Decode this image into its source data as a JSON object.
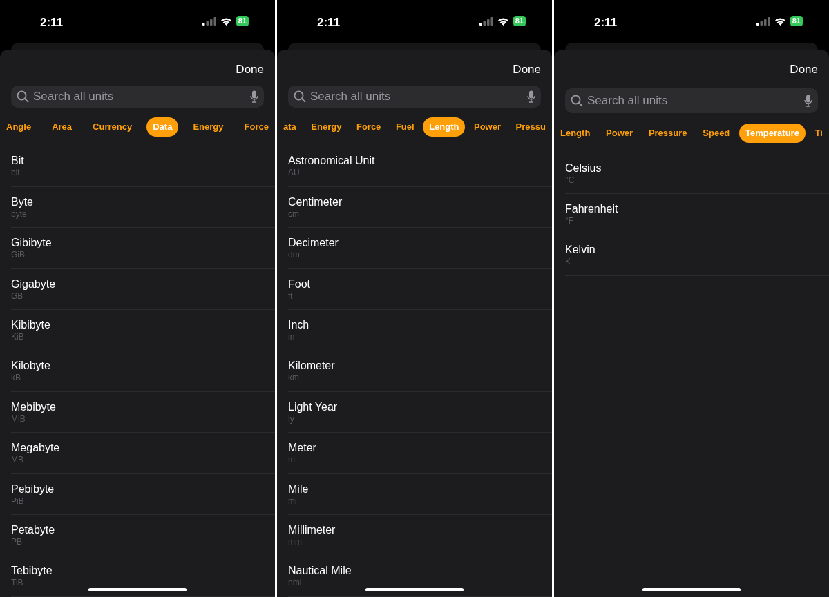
{
  "panels": [
    {
      "status": {
        "time": "2:11",
        "battery": "81"
      },
      "done": "Done",
      "search": {
        "placeholder": "Search all units"
      },
      "tabs": [
        {
          "label": "Angle",
          "selected": false
        },
        {
          "label": "Area",
          "selected": false
        },
        {
          "label": "Currency",
          "selected": false
        },
        {
          "label": "Data",
          "selected": true
        },
        {
          "label": "Energy",
          "selected": false
        },
        {
          "label": "Force",
          "selected": false
        }
      ],
      "units": [
        {
          "name": "Bit",
          "symbol": "bit"
        },
        {
          "name": "Byte",
          "symbol": "byte"
        },
        {
          "name": "Gibibyte",
          "symbol": "GiB"
        },
        {
          "name": "Gigabyte",
          "symbol": "GB"
        },
        {
          "name": "Kibibyte",
          "symbol": "KiB"
        },
        {
          "name": "Kilobyte",
          "symbol": "kB"
        },
        {
          "name": "Mebibyte",
          "symbol": "MiB"
        },
        {
          "name": "Megabyte",
          "symbol": "MB"
        },
        {
          "name": "Pebibyte",
          "symbol": "PiB"
        },
        {
          "name": "Petabyte",
          "symbol": "PB"
        },
        {
          "name": "Tebibyte",
          "symbol": "TiB"
        }
      ]
    },
    {
      "status": {
        "time": "2:11",
        "battery": "81"
      },
      "done": "Done",
      "search": {
        "placeholder": "Search all units"
      },
      "tabs": [
        {
          "label": "ata",
          "selected": false
        },
        {
          "label": "Energy",
          "selected": false
        },
        {
          "label": "Force",
          "selected": false
        },
        {
          "label": "Fuel",
          "selected": false
        },
        {
          "label": "Length",
          "selected": true
        },
        {
          "label": "Power",
          "selected": false
        },
        {
          "label": "Pressu",
          "selected": false
        }
      ],
      "units": [
        {
          "name": "Astronomical Unit",
          "symbol": "AU"
        },
        {
          "name": "Centimeter",
          "symbol": "cm"
        },
        {
          "name": "Decimeter",
          "symbol": "dm"
        },
        {
          "name": "Foot",
          "symbol": "ft"
        },
        {
          "name": "Inch",
          "symbol": "in"
        },
        {
          "name": "Kilometer",
          "symbol": "km"
        },
        {
          "name": "Light Year",
          "symbol": "ly"
        },
        {
          "name": "Meter",
          "symbol": "m"
        },
        {
          "name": "Mile",
          "symbol": "mi"
        },
        {
          "name": "Millimeter",
          "symbol": "mm"
        },
        {
          "name": "Nautical Mile",
          "symbol": "nmi"
        }
      ]
    },
    {
      "status": {
        "time": "2:11",
        "battery": "81"
      },
      "done": "Done",
      "search": {
        "placeholder": "Search all units"
      },
      "tabs": [
        {
          "label": "Length",
          "selected": false
        },
        {
          "label": "Power",
          "selected": false
        },
        {
          "label": "Pressure",
          "selected": false
        },
        {
          "label": "Speed",
          "selected": false
        },
        {
          "label": "Temperature",
          "selected": true
        },
        {
          "label": "Ti",
          "selected": false
        }
      ],
      "units": [
        {
          "name": "Celsius",
          "symbol": "°C"
        },
        {
          "name": "Fahrenheit",
          "symbol": "°F"
        },
        {
          "name": "Kelvin",
          "symbol": "K"
        }
      ]
    }
  ]
}
